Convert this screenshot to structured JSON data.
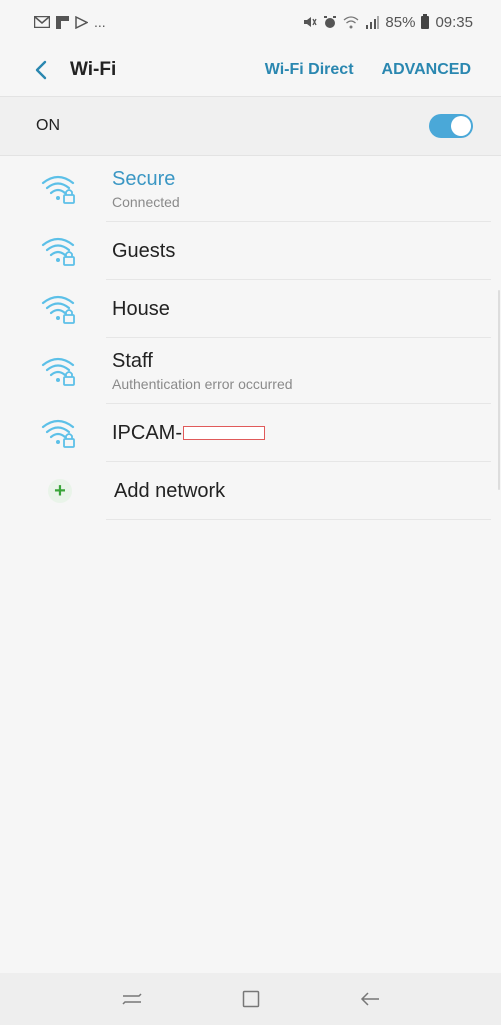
{
  "status_bar": {
    "left_icons": [
      "mail-icon",
      "flipboard-icon",
      "play-store-icon"
    ],
    "left_more": "...",
    "battery": "85%",
    "time": "09:35"
  },
  "app_bar": {
    "title": "Wi-Fi",
    "wifi_direct": "Wi-Fi Direct",
    "advanced": "ADVANCED"
  },
  "master": {
    "label": "ON",
    "enabled": true
  },
  "networks": [
    {
      "name": "Secure",
      "sub": "Connected",
      "connected": true
    },
    {
      "name": "Guests",
      "sub": ""
    },
    {
      "name": "House",
      "sub": ""
    },
    {
      "name": "Staff",
      "sub": "Authentication error occurred"
    },
    {
      "name": "IPCAM-",
      "sub": ""
    }
  ],
  "add_network": {
    "label": "Add network"
  },
  "colors": {
    "accent": "#2a87b0",
    "connected_text": "#3b97c4",
    "toggle_on": "#4aa8d8",
    "wifi_icon": "#5cc0e8",
    "add_icon": "#3aa53a"
  }
}
